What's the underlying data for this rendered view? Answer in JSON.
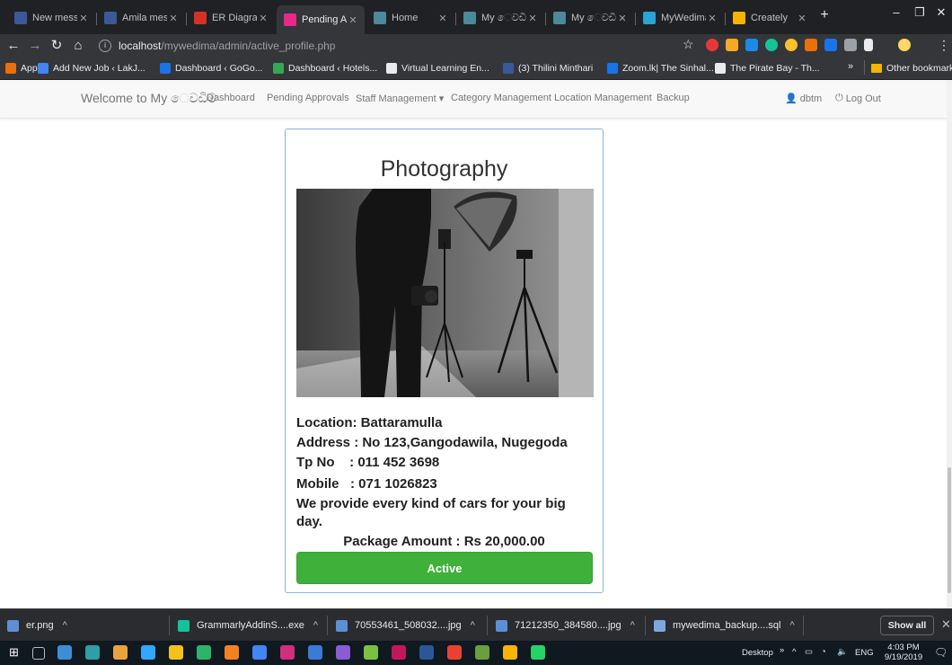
{
  "browser": {
    "tabs": [
      {
        "title": "New messa",
        "icon": "facebook-icon",
        "color": "#3b5998"
      },
      {
        "title": "Amila mess",
        "icon": "facebook-icon",
        "color": "#3b5998"
      },
      {
        "title": "ER Diagram",
        "icon": "gmail-icon",
        "color": "#d93025"
      },
      {
        "title": "Pending Ap",
        "icon": "site-icon",
        "color": "#e7298a"
      },
      {
        "title": "Home",
        "icon": "site-icon",
        "color": "#4a8a9a"
      },
      {
        "title": "My ෙවඩිම",
        "icon": "site-icon",
        "color": "#4a8a9a"
      },
      {
        "title": "My ෙවඩිම",
        "icon": "site-icon",
        "color": "#4a8a9a"
      },
      {
        "title": "MyWedima",
        "icon": "site-icon",
        "color": "#2aa3d6"
      },
      {
        "title": "Creately",
        "icon": "creately-icon",
        "color": "#f5b400"
      }
    ],
    "active_tab": 3,
    "window_controls": {
      "minimize": "–",
      "restore": "❐",
      "close": "✕"
    },
    "url": {
      "prefix": "localhost",
      "path": "/mywedima/admin/active_profile.php"
    },
    "bookmarks": [
      {
        "label": "Apps",
        "color": "#e8710a"
      },
      {
        "label": "Add New Job ‹ LakJ...",
        "color": "#4285f4"
      },
      {
        "label": "Dashboard ‹ GoGo...",
        "color": "#1a73e8"
      },
      {
        "label": "Dashboard ‹ Hotels...",
        "color": "#34a853"
      },
      {
        "label": "Virtual Learning En...",
        "color": "#e8eaed"
      },
      {
        "label": "(3) Thilini Minthari",
        "color": "#3b5998"
      },
      {
        "label": "Zoom.lk| The Sinhal...",
        "color": "#1a73e8"
      },
      {
        "label": "The Pirate Bay - Th...",
        "color": "#e8eaed"
      }
    ],
    "bookmarks_more": "»",
    "other_bookmarks": "Other bookmarks"
  },
  "navbar": {
    "brand": "Welcome to My ෙවඩිම",
    "links": [
      "Dashboard",
      "Pending Approvals",
      "Staff Management ▾",
      "Category Management",
      "Location Management",
      "Backup"
    ],
    "user": "dbtm",
    "logout": "Log Out"
  },
  "card": {
    "title": "Photography",
    "location": "Location: Battaramulla",
    "address": "Address : No 123,Gangodawila, Nugegoda",
    "tp_no": "Tp No    : 011 452 3698",
    "mobile": "Mobile   : 071 1026823",
    "description": "We provide every kind of cars for your big day.",
    "package": "Package Amount : Rs 20,000.00",
    "status_button": "Active",
    "accent": "#3fb13a"
  },
  "downloads": [
    {
      "name": "er.png",
      "color": "#5c8fd6"
    },
    {
      "name": "GrammarlyAddinS....exe",
      "color": "#15c39a"
    },
    {
      "name": "70553461_508032....jpg",
      "color": "#5c8fd6"
    },
    {
      "name": "71212350_384580....jpg",
      "color": "#5c8fd6"
    },
    {
      "name": "mywedima_backup....sql",
      "color": "#7aa7e0"
    }
  ],
  "download_caret": "^",
  "show_all": "Show all",
  "taskbar": {
    "desktop_label": "Desktop",
    "lang": "ENG",
    "time": "4:03 PM",
    "date": "9/19/2019",
    "apps": [
      "#3c8fd6",
      "#2f9ea6",
      "#e8a33d",
      "#31a8ff",
      "#f2c21b",
      "#2db36a",
      "#f58220",
      "#4285f4",
      "#d12e7e",
      "#3a7bd5",
      "#8a5cd6",
      "#7ac142",
      "#c2185b",
      "#2b579a",
      "#e94235",
      "#6a9e3f",
      "#f7b500",
      "#25d366"
    ]
  }
}
